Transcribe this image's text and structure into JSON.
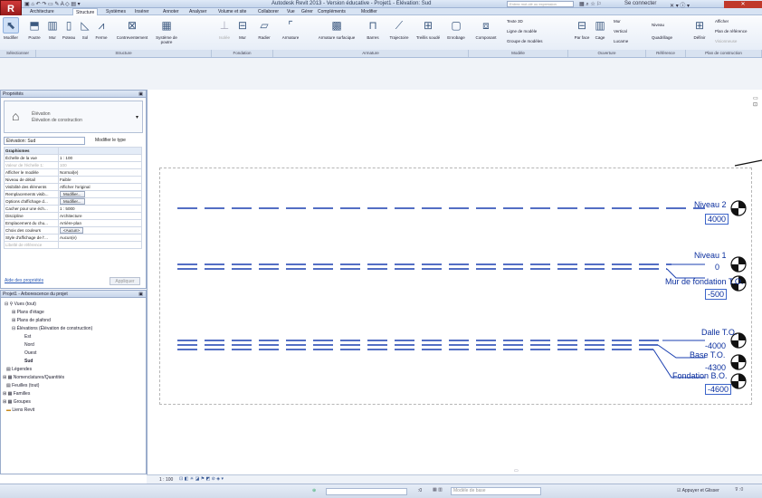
{
  "title": "Autodesk Revit 2013 - Version éducative -    Projet1 - Élévation: Sud",
  "search_placeholder": "Entrez mot-clé ou expression",
  "user": {
    "signin": "Se connecter"
  },
  "tabs": [
    "Architecture",
    "Structure",
    "Systèmes",
    "Insérer",
    "Annoter",
    "Analyser",
    "Volume et site",
    "Collaborer",
    "Vue",
    "Gérer",
    "Compléments",
    "Modifier"
  ],
  "ribbon": {
    "buttons": [
      "Modifier",
      "Poutre",
      "Mur",
      "Poteau",
      "Sol",
      "Ferme",
      "Contreventement",
      "Système de poutre",
      "Isolée",
      "Mur",
      "Radier",
      "Armature",
      "Armature surfacique",
      "Barres",
      "Trajectoire",
      "Treillis soudé",
      "Enrobage",
      "Composant"
    ],
    "modele": [
      "Texte 3D",
      "Ligne de modèle",
      "Groupe de modèles"
    ],
    "ouverture": [
      "Par face",
      "Cage",
      "Mur",
      "Vertical",
      "Lucarne"
    ],
    "reference": [
      "Niveau",
      "Quadrillage"
    ],
    "plan": [
      "Afficher",
      "Plan de référence",
      "Visionneuse",
      "Définir"
    ],
    "groups": [
      "Sélectionner",
      "Structure",
      "Fondation",
      "Armature",
      "Modèle",
      "Ouverture",
      "Référence",
      "Plan de construction"
    ]
  },
  "properties": {
    "header": "Propriétés",
    "type_line1": "Élévation",
    "type_line2": "Élévation de construction",
    "view_select": "Élévation: Sud",
    "edit_type": "Modifier le type",
    "rows": [
      [
        "Graphismes",
        ""
      ],
      [
        "Échelle de la vue",
        "1 : 100"
      ],
      [
        "Valeur de l'échelle  1:",
        "100"
      ],
      [
        "Afficher le modèle",
        "Normal(e)"
      ],
      [
        "Niveau de détail",
        "Faible"
      ],
      [
        "Visibilité des éléments",
        "Afficher l'original"
      ],
      [
        "Remplacements visib...",
        "Modifier..."
      ],
      [
        "Options d'affichage d...",
        "Modifier..."
      ],
      [
        "Cacher pour une éch...",
        "1 : 5000"
      ],
      [
        "Discipline",
        "Architecture"
      ],
      [
        "Emplacement du chu...",
        "Arrière-plan"
      ],
      [
        "Choix des couleurs",
        "<Aucun>"
      ],
      [
        "Style d'affichage de l'...",
        "Aucun(e)"
      ],
      [
        "Libellé de référence",
        ""
      ]
    ],
    "help_link": "Aide des propriétés",
    "apply": "Appliquer"
  },
  "browser": {
    "header": "Projet1 - Arborescence du projet",
    "items": [
      "Vues (tout)",
      "Plans d'étage",
      "Plans de plafond",
      "Élévations (Élévation de construction)",
      "Est",
      "Nord",
      "Ouest",
      "Sud",
      "Légendes",
      "Nomenclatures/Quantités",
      "Feuilles (tout)",
      "Familles",
      "Groupes",
      "Liens Revit"
    ]
  },
  "levels": [
    {
      "name": "Niveau 2",
      "value": "4000"
    },
    {
      "name": "Niveau 1",
      "value": "0"
    },
    {
      "name": "Mur de fondation T.O.",
      "value": "-500"
    },
    {
      "name": "Dalle T.O.",
      "value": "-4000"
    },
    {
      "name": "Base T.O.",
      "value": "-4300"
    },
    {
      "name": "Fondation B.O.",
      "value": "-4600"
    }
  ],
  "view_scale": "1 : 100",
  "status": {
    "base_model": "Modèle de base",
    "press_drag": "Appuyer et Glisser",
    "zero": ":0"
  }
}
